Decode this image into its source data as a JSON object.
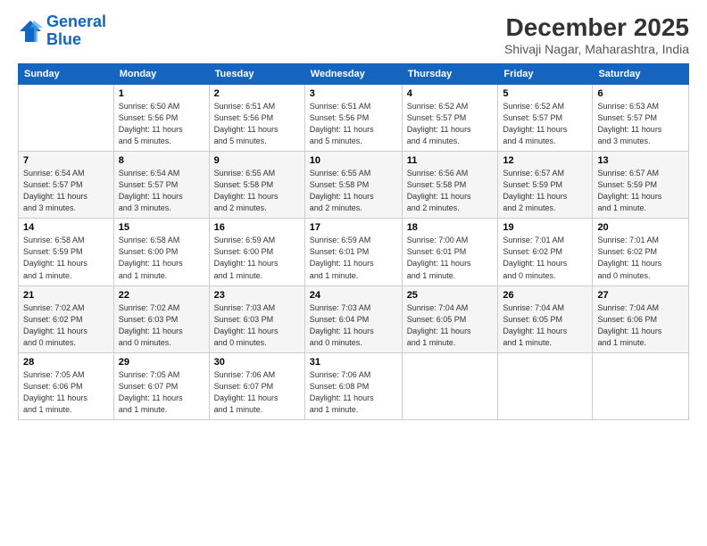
{
  "logo": {
    "line1": "General",
    "line2": "Blue"
  },
  "title": "December 2025",
  "subtitle": "Shivaji Nagar, Maharashtra, India",
  "days_header": [
    "Sunday",
    "Monday",
    "Tuesday",
    "Wednesday",
    "Thursday",
    "Friday",
    "Saturday"
  ],
  "weeks": [
    [
      {
        "num": "",
        "info": ""
      },
      {
        "num": "1",
        "info": "Sunrise: 6:50 AM\nSunset: 5:56 PM\nDaylight: 11 hours\nand 5 minutes."
      },
      {
        "num": "2",
        "info": "Sunrise: 6:51 AM\nSunset: 5:56 PM\nDaylight: 11 hours\nand 5 minutes."
      },
      {
        "num": "3",
        "info": "Sunrise: 6:51 AM\nSunset: 5:56 PM\nDaylight: 11 hours\nand 5 minutes."
      },
      {
        "num": "4",
        "info": "Sunrise: 6:52 AM\nSunset: 5:57 PM\nDaylight: 11 hours\nand 4 minutes."
      },
      {
        "num": "5",
        "info": "Sunrise: 6:52 AM\nSunset: 5:57 PM\nDaylight: 11 hours\nand 4 minutes."
      },
      {
        "num": "6",
        "info": "Sunrise: 6:53 AM\nSunset: 5:57 PM\nDaylight: 11 hours\nand 3 minutes."
      }
    ],
    [
      {
        "num": "7",
        "info": "Sunrise: 6:54 AM\nSunset: 5:57 PM\nDaylight: 11 hours\nand 3 minutes."
      },
      {
        "num": "8",
        "info": "Sunrise: 6:54 AM\nSunset: 5:57 PM\nDaylight: 11 hours\nand 3 minutes."
      },
      {
        "num": "9",
        "info": "Sunrise: 6:55 AM\nSunset: 5:58 PM\nDaylight: 11 hours\nand 2 minutes."
      },
      {
        "num": "10",
        "info": "Sunrise: 6:55 AM\nSunset: 5:58 PM\nDaylight: 11 hours\nand 2 minutes."
      },
      {
        "num": "11",
        "info": "Sunrise: 6:56 AM\nSunset: 5:58 PM\nDaylight: 11 hours\nand 2 minutes."
      },
      {
        "num": "12",
        "info": "Sunrise: 6:57 AM\nSunset: 5:59 PM\nDaylight: 11 hours\nand 2 minutes."
      },
      {
        "num": "13",
        "info": "Sunrise: 6:57 AM\nSunset: 5:59 PM\nDaylight: 11 hours\nand 1 minute."
      }
    ],
    [
      {
        "num": "14",
        "info": "Sunrise: 6:58 AM\nSunset: 5:59 PM\nDaylight: 11 hours\nand 1 minute."
      },
      {
        "num": "15",
        "info": "Sunrise: 6:58 AM\nSunset: 6:00 PM\nDaylight: 11 hours\nand 1 minute."
      },
      {
        "num": "16",
        "info": "Sunrise: 6:59 AM\nSunset: 6:00 PM\nDaylight: 11 hours\nand 1 minute."
      },
      {
        "num": "17",
        "info": "Sunrise: 6:59 AM\nSunset: 6:01 PM\nDaylight: 11 hours\nand 1 minute."
      },
      {
        "num": "18",
        "info": "Sunrise: 7:00 AM\nSunset: 6:01 PM\nDaylight: 11 hours\nand 1 minute."
      },
      {
        "num": "19",
        "info": "Sunrise: 7:01 AM\nSunset: 6:02 PM\nDaylight: 11 hours\nand 0 minutes."
      },
      {
        "num": "20",
        "info": "Sunrise: 7:01 AM\nSunset: 6:02 PM\nDaylight: 11 hours\nand 0 minutes."
      }
    ],
    [
      {
        "num": "21",
        "info": "Sunrise: 7:02 AM\nSunset: 6:02 PM\nDaylight: 11 hours\nand 0 minutes."
      },
      {
        "num": "22",
        "info": "Sunrise: 7:02 AM\nSunset: 6:03 PM\nDaylight: 11 hours\nand 0 minutes."
      },
      {
        "num": "23",
        "info": "Sunrise: 7:03 AM\nSunset: 6:03 PM\nDaylight: 11 hours\nand 0 minutes."
      },
      {
        "num": "24",
        "info": "Sunrise: 7:03 AM\nSunset: 6:04 PM\nDaylight: 11 hours\nand 0 minutes."
      },
      {
        "num": "25",
        "info": "Sunrise: 7:04 AM\nSunset: 6:05 PM\nDaylight: 11 hours\nand 1 minute."
      },
      {
        "num": "26",
        "info": "Sunrise: 7:04 AM\nSunset: 6:05 PM\nDaylight: 11 hours\nand 1 minute."
      },
      {
        "num": "27",
        "info": "Sunrise: 7:04 AM\nSunset: 6:06 PM\nDaylight: 11 hours\nand 1 minute."
      }
    ],
    [
      {
        "num": "28",
        "info": "Sunrise: 7:05 AM\nSunset: 6:06 PM\nDaylight: 11 hours\nand 1 minute."
      },
      {
        "num": "29",
        "info": "Sunrise: 7:05 AM\nSunset: 6:07 PM\nDaylight: 11 hours\nand 1 minute."
      },
      {
        "num": "30",
        "info": "Sunrise: 7:06 AM\nSunset: 6:07 PM\nDaylight: 11 hours\nand 1 minute."
      },
      {
        "num": "31",
        "info": "Sunrise: 7:06 AM\nSunset: 6:08 PM\nDaylight: 11 hours\nand 1 minute."
      },
      {
        "num": "",
        "info": ""
      },
      {
        "num": "",
        "info": ""
      },
      {
        "num": "",
        "info": ""
      }
    ]
  ]
}
